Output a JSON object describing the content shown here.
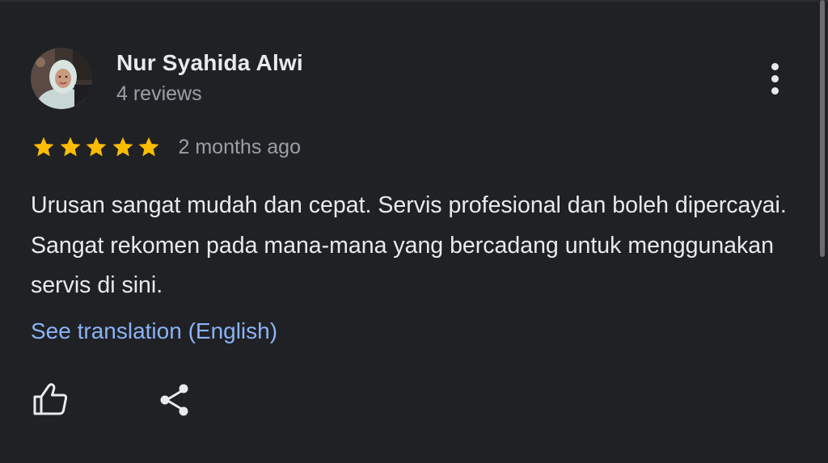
{
  "review": {
    "author_name": "Nur Syahida Alwi",
    "review_count": "4 reviews",
    "rating": 5,
    "rating_max": 5,
    "time_ago": "2 months ago",
    "text": "Urusan sangat mudah dan cepat. Servis profesional dan boleh dipercayai. Sangat rekomen pada mana-mana yang bercadang untuk menggunakan servis di sini.",
    "translate_link": "See translation (English)"
  },
  "icons": {
    "avatar": "profile-photo",
    "more": "more-vert-icon",
    "star": "star-icon",
    "like": "thumb-up-icon",
    "share": "share-icon"
  },
  "colors": {
    "background": "#202124",
    "primary_text": "#e8eaed",
    "secondary_text": "#9aa0a6",
    "link": "#8ab4f8",
    "star": "#fbbc04"
  }
}
